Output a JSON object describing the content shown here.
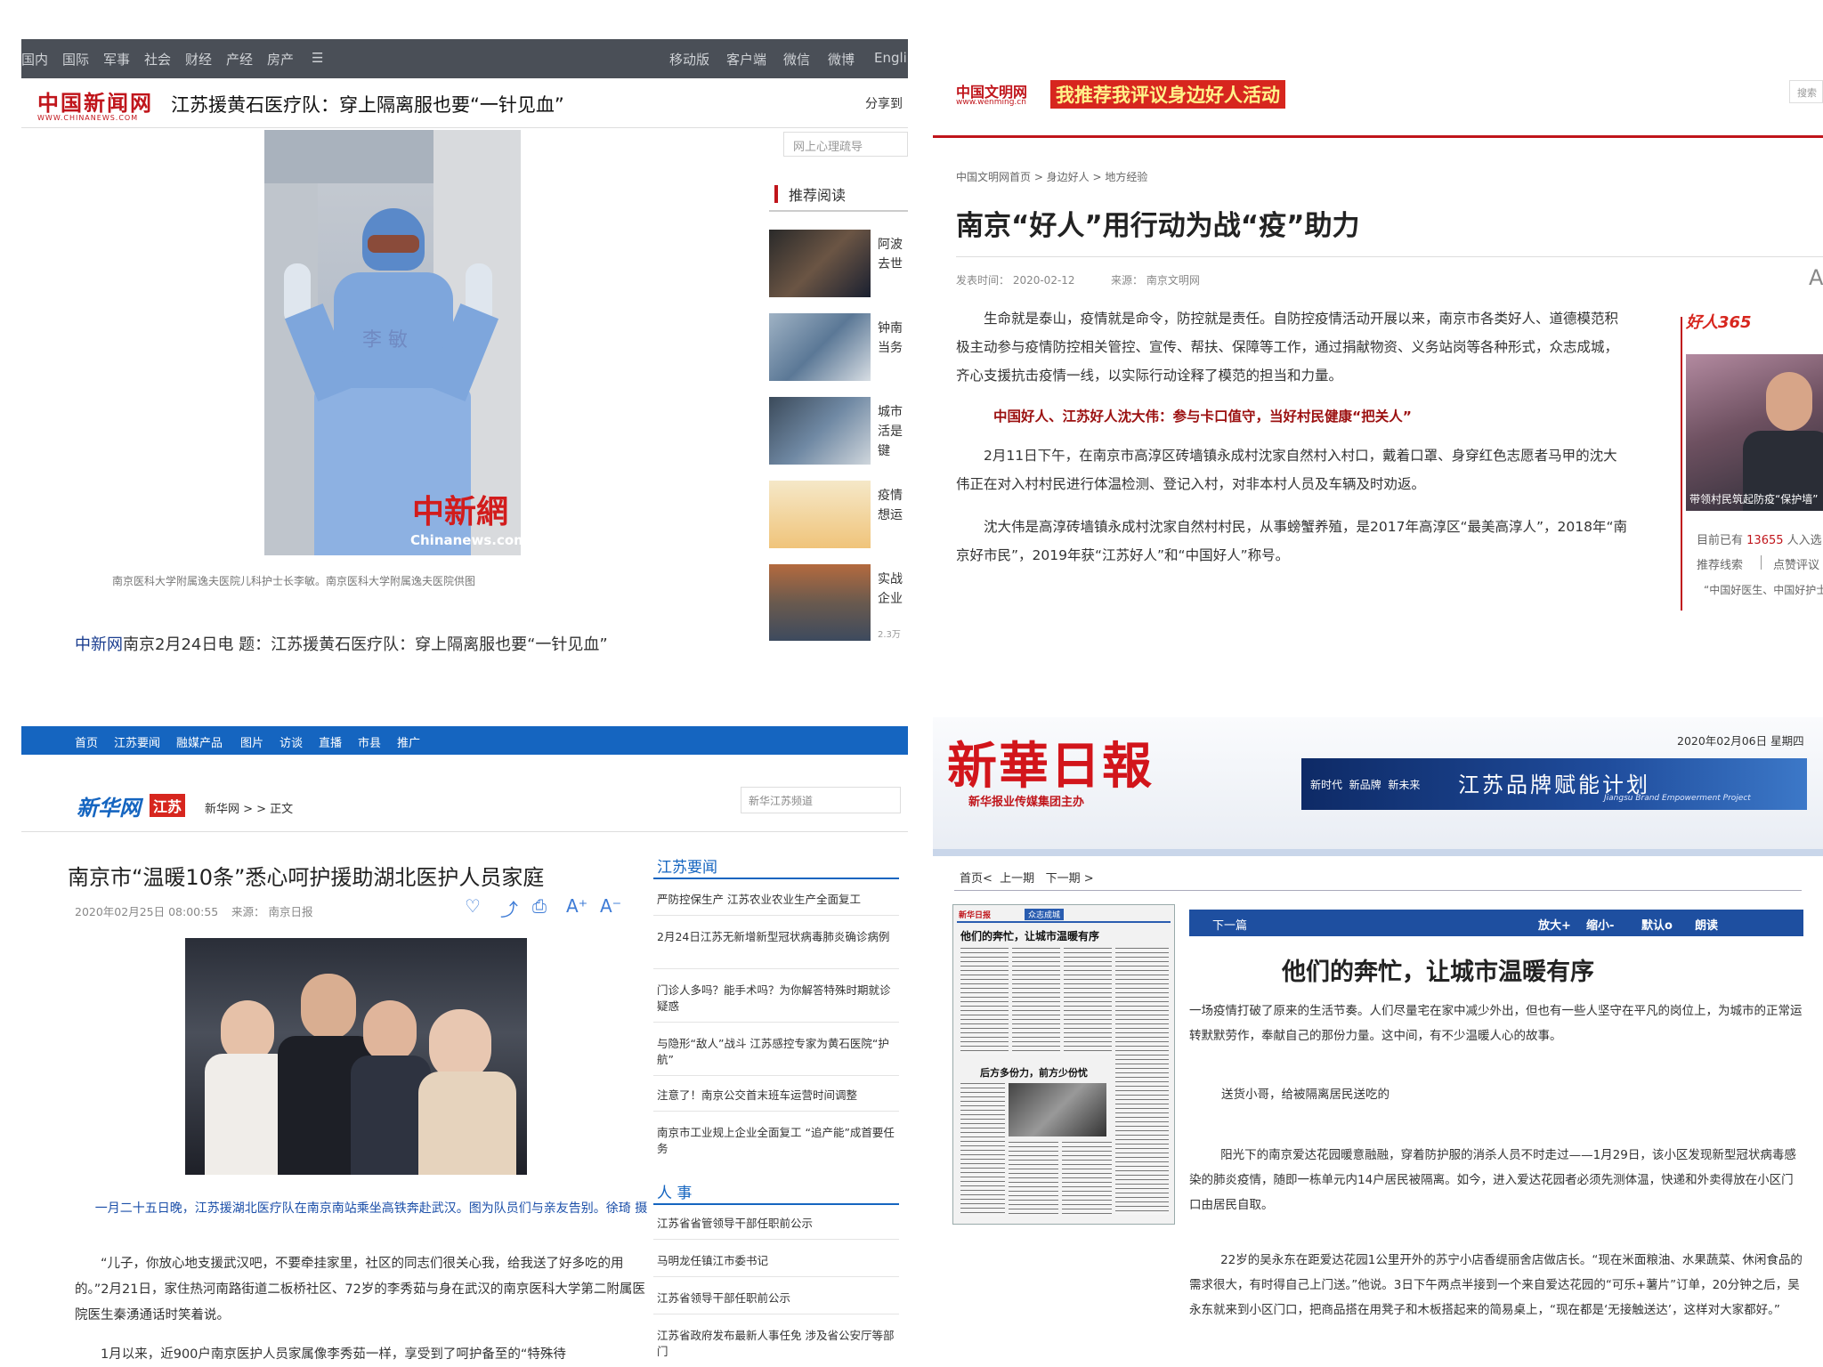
{
  "q1": {
    "topnav_left": [
      "国内",
      "国际",
      "军事",
      "社会",
      "财经",
      "产经",
      "房产",
      "☰"
    ],
    "topnav_right": [
      "移动版",
      "客户端",
      "微信",
      "微博",
      "Engli"
    ],
    "logo": "中国新闻网",
    "logo_sub": "WWW.CHINANEWS.COM",
    "title": "江苏援黄石医疗队：穿上隔离服也要“一针见血”",
    "share": "分享到",
    "search_placeholder": "网上心理疏导",
    "watermark_cn": "中新網",
    "watermark_en": "Chinanews.com",
    "photo_caption": "南京医科大学附属逸夫医院儿科护士长李敏。南京医科大学附属逸夫医院供图",
    "recommend_title": "推荐阅读",
    "recommend": [
      {
        "text": "阿波去世"
      },
      {
        "text": "钟南当务"
      },
      {
        "text": "城市活是键"
      },
      {
        "text": "疫情想运"
      },
      {
        "text": "实战企业"
      }
    ],
    "rec_count": "2.3万",
    "lead_source": "中新网",
    "lead_text": "南京2月24日电 题：江苏援黄石医疗队：穿上隔离服也要“一针见血”"
  },
  "q2": {
    "logo": "中国文明网",
    "logo_sub": "www.wenming.cn",
    "banner": "我推荐我评议身边好人活动",
    "search_btn": "搜索",
    "breadcrumb": "中国文明网首页 > 身边好人 > 地方经验",
    "headline": "南京“好人”用行动为战“疫”助力",
    "meta_date": "发表时间： 2020-02-12",
    "meta_source": "来源： 南京文明网",
    "font_btn": "A",
    "para1": "生命就是泰山，疫情就是命令，防控就是责任。自防控疫情活动开展以来，南京市各类好人、道德模范积极主动参与疫情防控相关管控、宣传、帮扶、保障等工作，通过捐献物资、义务站岗等各种形式，众志成城，齐心支援抗击疫情一线，以实际行动诠释了模范的担当和力量。",
    "subhead": "中国好人、江苏好人沈大伟：参与卡口值守，当好村民健康“把关人”",
    "para2": "2月11日下午，在南京市高淳区砖墙镇永成村沈家自然村入村口，戴着口罩、身穿红色志愿者马甲的沈大伟正在对入村村民进行体温检测、登记入村，对非本村人员及车辆及时劝返。",
    "para3": "沈大伟是高淳砖墙镇永成村沈家自然村村民，从事螃蟹养殖，是2017年高淳区“最美高淳人”，2018年“南京好市民”，2019年获“江苏好人”和“中国好人”称号。",
    "side_logo": "好人365",
    "side_caption": "带领村民筑起防疫“保护墙”",
    "side_count_prefix": "目前已有",
    "side_count": "13655",
    "side_count_suffix": "人入选",
    "side_link1": "推荐线索",
    "side_link2": "点赞评议",
    "side_more": "“中国好医生、中国好护士”"
  },
  "q3": {
    "nav": [
      "首页",
      "江苏要闻",
      "融媒产品",
      "图片",
      "访谈",
      "直播",
      "市县",
      "推广"
    ],
    "logo": "新华网",
    "logo_tag": "江苏",
    "breadcrumb": "新华网 > > 正文",
    "search_placeholder": "新华江苏频道",
    "title": "南京市“温暖10条”悉心呵护援助湖北医护人员家庭",
    "date": "2020年02月25日 08:00:55",
    "source": "来源： 南京日报",
    "tools": [
      "♡",
      "⤴",
      "⎙",
      "A⁺",
      "A⁻"
    ],
    "caption": "一月二十五日晚，江苏援湖北医疗队在南京南站乘坐高铁奔赴武汉。图为队员们与亲友告别。徐琦 摄",
    "para1": "“儿子，你放心地支援武汉吧，不要牵挂家里，社区的同志们很关心我，给我送了好多吃的用的。”2月21日，家住热河南路街道二板桥社区、72岁的李秀茹与身在武汉的南京医科大学第二附属医院医生秦湧通话时笑着说。",
    "para2": "1月以来，近900户南京医护人员家属像李秀茹一样，享受到了呵护备至的“特殊待",
    "side_title1": "江苏要闻",
    "side_news": [
      "严防控保生产 江苏农业农业生产全面复工",
      "2月24日江苏无新增新型冠状病毒肺炎确诊病例",
      "门诊人多吗？能手术吗？为你解答特殊时期就诊疑惑",
      "与隐形“敌人”战斗 江苏感控专家为黄石医院“护航”",
      "注意了！南京公交首末班车运营时间调整",
      "南京市工业规上企业全面复工 “追产能”成首要任务"
    ],
    "side_title2": "人  事",
    "side_people": [
      "江苏省省管领导干部任职前公示",
      "马明龙任镇江市委书记",
      "江苏省领导干部任职前公示",
      "江苏省政府发布最新人事任免 涉及省公安厅等部门"
    ]
  },
  "q4": {
    "masthead": "新華日報",
    "publisher": "新华报业传媒集团主办",
    "date": "2020年02月06日 星期四",
    "banner_left": [
      "新时代",
      "新品牌",
      "新未来"
    ],
    "banner_main": "江苏品牌赋能计划",
    "banner_en": "Jiangsu Brand Empowerment Project",
    "breadcrumb": [
      "首页<",
      "上一期",
      "下一期 >"
    ],
    "page_header": "新华日报",
    "page_section": "众志成城",
    "page_headline1": "他们的奔忙，让城市温暖有序",
    "page_headline2": "后方多份力，前方少份忧",
    "article_bar_left": "下一篇",
    "article_tools": [
      "放大+",
      "缩小-",
      "默认o",
      "朗读"
    ],
    "headline": "他们的奔忙，让城市温暖有序",
    "para1": "一场疫情打破了原来的生活节奏。人们尽量宅在家中减少外出，但也有一些人坚守在平凡的岗位上，为城市的正常运转默默劳作，奉献自己的那份力量。这中间，有不少温暖人心的故事。",
    "subhead": "送货小哥，给被隔离居民送吃的",
    "para2": "阳光下的南京爱达花园暖意融融，穿着防护服的消杀人员不时走过——1月29日，该小区发现新型冠状病毒感染的肺炎疫情，随即一栋单元内14户居民被隔离。如今，进入爱达花园者必须先测体温，快递和外卖得放在小区门口由居民自取。",
    "para3": "22岁的吴永东在距爱达花园1公里开外的苏宁小店香缇丽舍店做店长。“现在米面粮油、水果蔬菜、休闲食品的需求很大，有时得自己上门送。”他说。3日下午两点半接到一个来自爱达花园的“可乐+薯片”订单，20分钟之后，吴永东就来到小区门口，把商品搭在用凳子和木板搭起来的简易桌上，“现在都是‘无接触送达’，这样对大家都好。”"
  }
}
